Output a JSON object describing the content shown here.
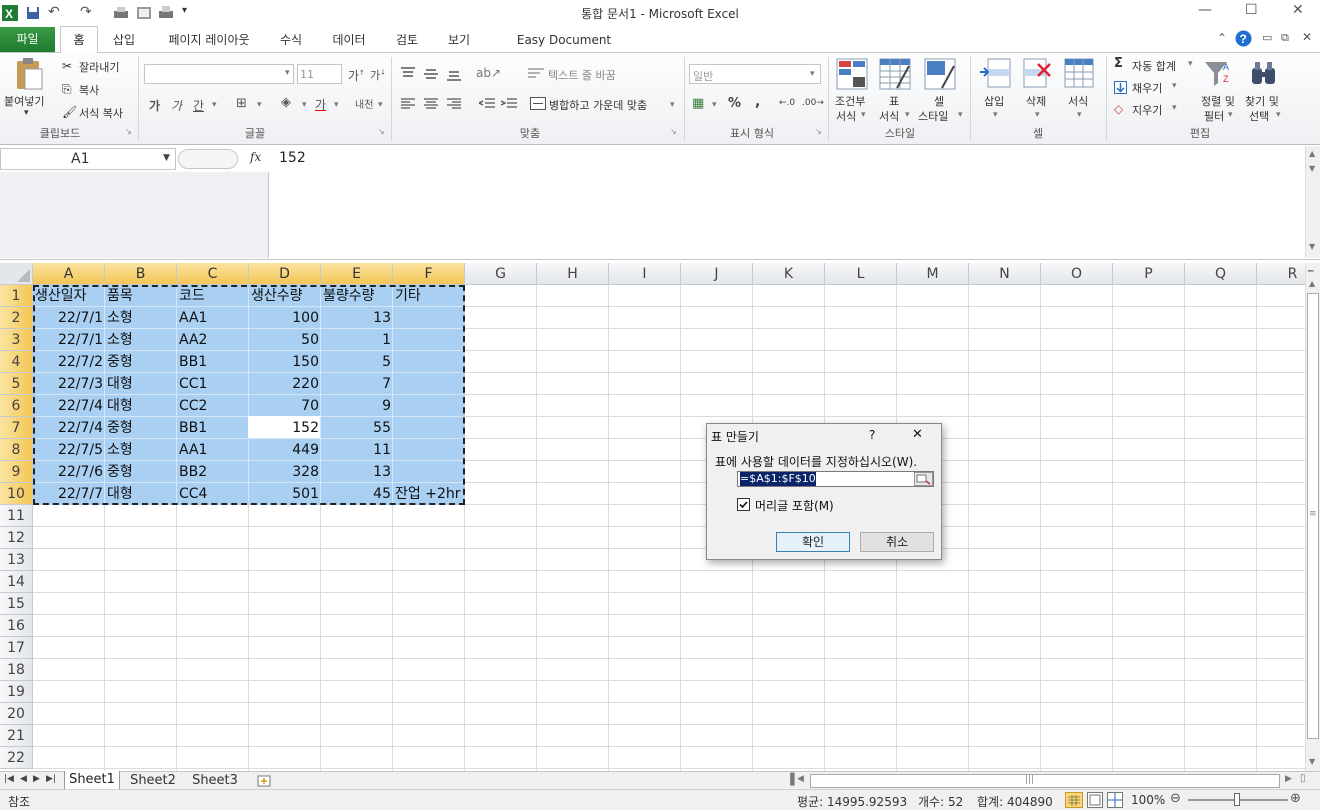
{
  "titlebar": {
    "title": "통합 문서1  -  Microsoft Excel",
    "minimize": "—",
    "maximize": "☐",
    "close": "✕"
  },
  "tabs": {
    "file": "파일",
    "home": "홈",
    "insert": "삽입",
    "layout": "페이지 레이아웃",
    "formulas": "수식",
    "data": "데이터",
    "review": "검토",
    "view": "보기",
    "addin": "Easy Document Creator"
  },
  "ribbon": {
    "clipboard": {
      "paste": "붙여넣기",
      "cut": "잘라내기",
      "copy": "복사",
      "format_painter": "서식 복사",
      "label": "클립보드"
    },
    "font": {
      "size": "11",
      "bold": "가",
      "italic": "가",
      "underline": "간",
      "label": "글꼴",
      "phonetic": "내천"
    },
    "align": {
      "wrap": "텍스트 줄 바꿈",
      "merge": "병합하고 가운데 맞춤",
      "label": "맞춤"
    },
    "number": {
      "format": "일반",
      "percent": "%",
      "comma": ",",
      "label": "표시 형식"
    },
    "styles": {
      "cond": "조건부",
      "cond2": "서식",
      "table": "표",
      "table2": "서식",
      "cell": "셀",
      "cell2": "스타일",
      "label": "스타일"
    },
    "cells": {
      "insert": "삽입",
      "delete": "삭제",
      "format": "서식",
      "label": "셀"
    },
    "editing": {
      "autosum": "자동 합계",
      "fill": "채우기",
      "clear": "지우기",
      "sort": "정렬 및",
      "sort2": "필터",
      "find": "찾기 및",
      "find2": "선택",
      "label": "편집"
    }
  },
  "formula_bar": {
    "name_box": "A1",
    "fx": "fx",
    "value": "152"
  },
  "columns": [
    "A",
    "B",
    "C",
    "D",
    "E",
    "F",
    "G",
    "H",
    "I",
    "J",
    "K",
    "L",
    "M",
    "N",
    "O",
    "P",
    "Q",
    "R"
  ],
  "rows": [
    "1",
    "2",
    "3",
    "4",
    "5",
    "6",
    "7",
    "8",
    "9",
    "10",
    "11",
    "12",
    "13",
    "14",
    "15",
    "16",
    "17",
    "18",
    "19",
    "20",
    "21",
    "22"
  ],
  "table": {
    "headers": [
      "생산일자",
      "품목",
      "코드",
      "생산수량",
      "불량수량",
      "기타"
    ],
    "rows": [
      [
        "22/7/1",
        "소형",
        "AA1",
        "100",
        "13",
        ""
      ],
      [
        "22/7/1",
        "소형",
        "AA2",
        "50",
        "1",
        ""
      ],
      [
        "22/7/2",
        "중형",
        "BB1",
        "150",
        "5",
        ""
      ],
      [
        "22/7/3",
        "대형",
        "CC1",
        "220",
        "7",
        ""
      ],
      [
        "22/7/4",
        "대형",
        "CC2",
        "70",
        "9",
        ""
      ],
      [
        "22/7/4",
        "중형",
        "BB1",
        "152",
        "55",
        ""
      ],
      [
        "22/7/5",
        "소형",
        "AA1",
        "449",
        "11",
        ""
      ],
      [
        "22/7/6",
        "중형",
        "BB2",
        "328",
        "13",
        ""
      ],
      [
        "22/7/7",
        "대형",
        "CC4",
        "501",
        "45",
        "잔업 +2hr"
      ]
    ]
  },
  "dialog": {
    "title": "표 만들기",
    "help": "?",
    "close": "✕",
    "prompt": "표에 사용할 데이터를 지정하십시오(W).",
    "range": "=$A$1:$F$10",
    "checkbox": "머리글 포함(M)",
    "checked": true,
    "ok": "확인",
    "cancel": "취소"
  },
  "sheets": [
    "Sheet1",
    "Sheet2",
    "Sheet3"
  ],
  "status": {
    "mode": "참조",
    "average": "평균: 14995.92593",
    "count": "개수: 52",
    "sum": "합계: 404890",
    "zoom": "100%"
  }
}
